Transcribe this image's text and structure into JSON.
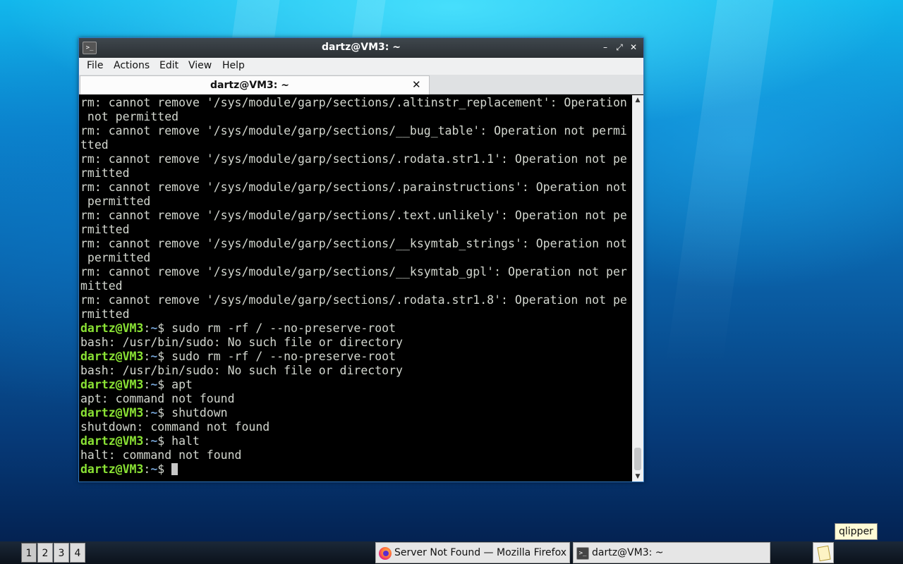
{
  "window": {
    "title": "dartz@VM3: ~",
    "icon": "terminal-icon",
    "minimize_icon": "minimize-icon",
    "maximize_icon": "maximize-icon",
    "close_icon": "close-icon"
  },
  "menu": {
    "items": [
      {
        "label": "File"
      },
      {
        "label": "Actions"
      },
      {
        "label": "Edit"
      },
      {
        "label": "View"
      },
      {
        "label": "Help"
      }
    ]
  },
  "tab": {
    "label": "dartz@VM3: ~",
    "close_glyph": "✕"
  },
  "terminal": {
    "lines": [
      {
        "text": "rm: cannot remove '/sys/module/garp/sections/.altinstr_replacement': Operation"
      },
      {
        "text": " not permitted"
      },
      {
        "text": "rm: cannot remove '/sys/module/garp/sections/__bug_table': Operation not permi"
      },
      {
        "text": "tted"
      },
      {
        "text": "rm: cannot remove '/sys/module/garp/sections/.rodata.str1.1': Operation not pe"
      },
      {
        "text": "rmitted"
      },
      {
        "text": "rm: cannot remove '/sys/module/garp/sections/.parainstructions': Operation not"
      },
      {
        "text": " permitted"
      },
      {
        "text": "rm: cannot remove '/sys/module/garp/sections/.text.unlikely': Operation not pe"
      },
      {
        "text": "rmitted"
      },
      {
        "text": "rm: cannot remove '/sys/module/garp/sections/__ksymtab_strings': Operation not"
      },
      {
        "text": " permitted"
      },
      {
        "text": "rm: cannot remove '/sys/module/garp/sections/__ksymtab_gpl': Operation not per"
      },
      {
        "text": "mitted"
      },
      {
        "text": "rm: cannot remove '/sys/module/garp/sections/.rodata.str1.8': Operation not pe"
      },
      {
        "text": "rmitted"
      },
      {
        "prompt": true,
        "user": "dartz@VM3",
        "sep": ":",
        "path": "~",
        "cmd": "$ sudo rm -rf / --no-preserve-root"
      },
      {
        "text": "bash: /usr/bin/sudo: No such file or directory"
      },
      {
        "prompt": true,
        "user": "dartz@VM3",
        "sep": ":",
        "path": "~",
        "cmd": "$ sudo rm -rf / --no-preserve-root"
      },
      {
        "text": "bash: /usr/bin/sudo: No such file or directory"
      },
      {
        "prompt": true,
        "user": "dartz@VM3",
        "sep": ":",
        "path": "~",
        "cmd": "$ apt"
      },
      {
        "text": "apt: command not found"
      },
      {
        "prompt": true,
        "user": "dartz@VM3",
        "sep": ":",
        "path": "~",
        "cmd": "$ shutdown"
      },
      {
        "text": "shutdown: command not found"
      },
      {
        "prompt": true,
        "user": "dartz@VM3",
        "sep": ":",
        "path": "~",
        "cmd": "$ halt"
      },
      {
        "text": "halt: command not found"
      },
      {
        "prompt": true,
        "user": "dartz@VM3",
        "sep": ":",
        "path": "~",
        "cmd": "$ ",
        "cursor": true
      }
    ],
    "colors": {
      "user": "#8ae234",
      "path": "#729fcf",
      "text": "#d3d7cf",
      "background": "#000000"
    },
    "scroll_position": 0.98
  },
  "tooltip": {
    "text": "qlipper"
  },
  "taskbar": {
    "workspaces": [
      "1",
      "2",
      "3",
      "4"
    ],
    "active_workspace": "1",
    "tasks": [
      {
        "label": "Server Not Found — Mozilla Firefox",
        "icon": "firefox-icon"
      },
      {
        "label": "dartz@VM3: ~",
        "icon": "terminal-icon"
      }
    ],
    "tray_icon": "clipboard-icon"
  }
}
